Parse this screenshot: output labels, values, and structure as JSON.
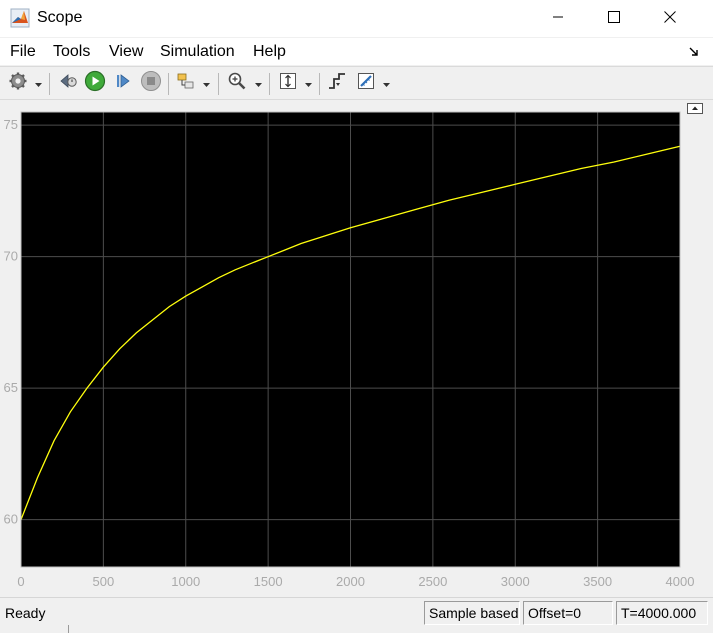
{
  "window": {
    "title": "Scope",
    "icons": {
      "app": "matlab-logo-icon",
      "minimize": "minimize-icon",
      "maximize": "maximize-icon",
      "close": "close-icon"
    }
  },
  "menubar": {
    "items": [
      "File",
      "Tools",
      "View",
      "Simulation",
      "Help"
    ],
    "dock_icon": "dock-arrow-icon"
  },
  "toolbar": {
    "buttons": [
      {
        "name": "settings",
        "icon": "gear-icon",
        "dropdown": true
      },
      {
        "name": "step-back",
        "icon": "step-back-icon"
      },
      {
        "name": "run",
        "icon": "run-icon"
      },
      {
        "name": "step-forward",
        "icon": "step-forward-icon"
      },
      {
        "name": "stop",
        "icon": "stop-icon"
      },
      {
        "name": "highlight-simulink-block",
        "icon": "block-highlight-icon",
        "dropdown": true
      },
      {
        "name": "zoom",
        "icon": "zoom-in-icon",
        "dropdown": true
      },
      {
        "name": "scale-axes",
        "icon": "autoscale-icon",
        "dropdown": true
      },
      {
        "name": "triggers",
        "icon": "trigger-icon"
      },
      {
        "name": "cursor-measurements",
        "icon": "measure-icon",
        "dropdown": true
      }
    ]
  },
  "plot": {
    "undock_icon": "undock-icon"
  },
  "chart_data": {
    "type": "line",
    "title": "",
    "xlabel": "",
    "ylabel": "",
    "xlim": [
      0,
      4000
    ],
    "ylim": [
      58.2,
      75.5
    ],
    "xticks": [
      "0",
      "500",
      "1000",
      "1500",
      "2000",
      "2500",
      "3000",
      "3500",
      "4000"
    ],
    "yticks": [
      "60",
      "65",
      "70",
      "75"
    ],
    "grid": true,
    "background": "#000000",
    "grid_color": "#4d4d4d",
    "tick_label_color": "#aaaaaa",
    "series": [
      {
        "color": "#ffff0d",
        "x": [
          0,
          100,
          200,
          300,
          400,
          500,
          600,
          700,
          800,
          900,
          1000,
          1100,
          1200,
          1300,
          1400,
          1500,
          1600,
          1700,
          1800,
          1900,
          2000,
          2200,
          2400,
          2600,
          2800,
          3000,
          3200,
          3400,
          3600,
          3800,
          4000
        ],
        "y": [
          60.0,
          61.6,
          63.0,
          64.1,
          65.0,
          65.8,
          66.5,
          67.1,
          67.6,
          68.1,
          68.5,
          68.85,
          69.2,
          69.5,
          69.75,
          70.0,
          70.25,
          70.5,
          70.7,
          70.9,
          71.1,
          71.45,
          71.8,
          72.15,
          72.45,
          72.75,
          73.05,
          73.35,
          73.6,
          73.9,
          74.2
        ]
      }
    ]
  },
  "status": {
    "ready": "Ready",
    "mode": "Sample based",
    "offset": "Offset=0",
    "time": "T=4000.000"
  }
}
